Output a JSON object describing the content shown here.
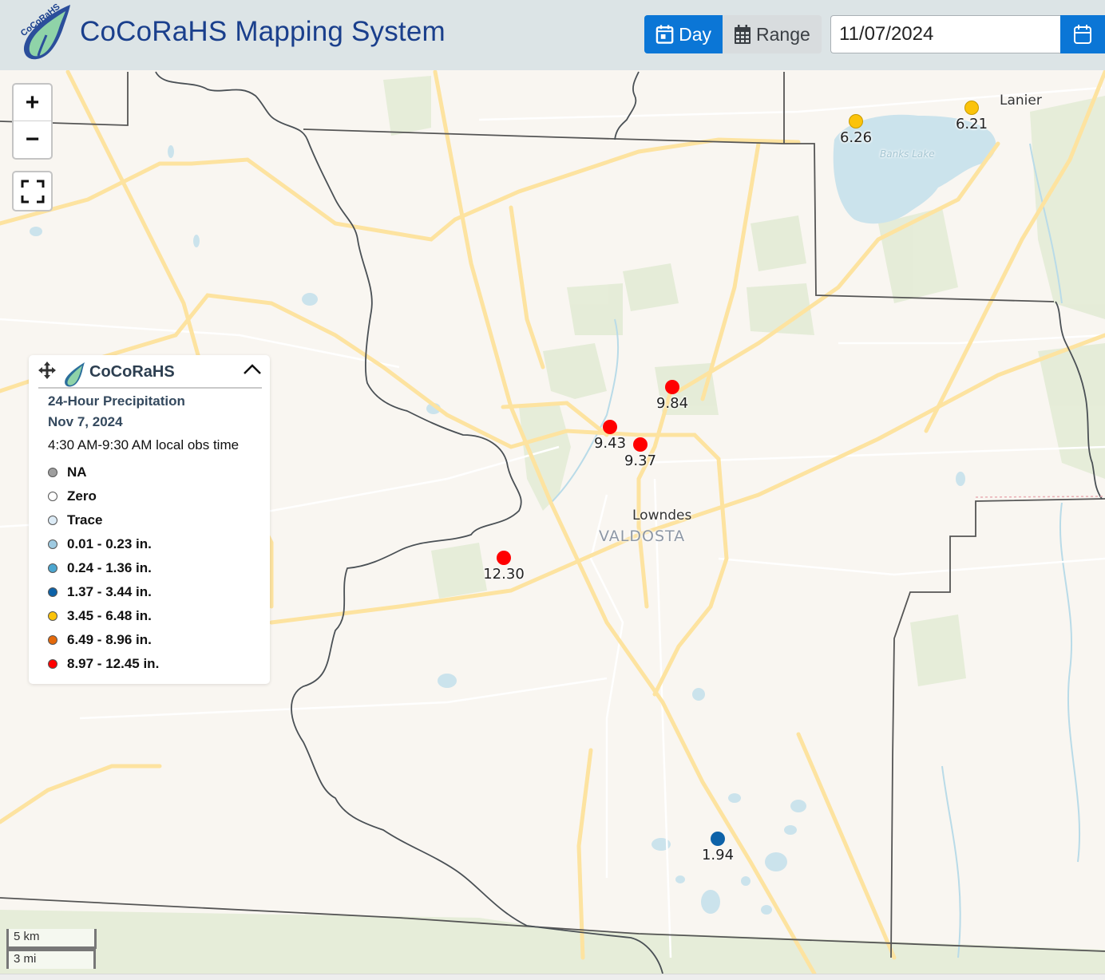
{
  "header": {
    "title": "CoCoRaHS Mapping System",
    "logo_text": "CoCoRaHS",
    "mode_buttons": [
      {
        "label": "Day",
        "icon": "calendar-day-icon",
        "active": true
      },
      {
        "label": "Range",
        "icon": "calendar-grid-icon",
        "active": false
      }
    ],
    "date_value": "11/07/2024",
    "date_picker_icon": "calendar-icon"
  },
  "map_controls": {
    "zoom_in": "+",
    "zoom_out": "−",
    "fullscreen_icon": "fullscreen-icon"
  },
  "legend": {
    "brand": "CoCoRaHS",
    "title": "24-Hour Precipitation",
    "date": "Nov 7, 2024",
    "obs_time": "4:30 AM-9:30 AM local obs time",
    "items": [
      {
        "label": "NA",
        "color": "#9e9e9e"
      },
      {
        "label": "Zero",
        "color": "#ffffff"
      },
      {
        "label": "Trace",
        "color": "#dcebf6"
      },
      {
        "label": "0.01 - 0.23 in.",
        "color": "#9ecae1"
      },
      {
        "label": "0.24 - 1.36 in.",
        "color": "#4ba6d0"
      },
      {
        "label": "1.37 - 3.44 in.",
        "color": "#0d62a8"
      },
      {
        "label": "3.45 - 6.48 in.",
        "color": "#fbc30a"
      },
      {
        "label": "6.49 - 8.96 in.",
        "color": "#e4690b"
      },
      {
        "label": "8.97 - 12.45 in.",
        "color": "#ff0000"
      }
    ]
  },
  "stations": [
    {
      "value": "6.26",
      "color": "#fbc30a"
    },
    {
      "value": "6.21",
      "color": "#fbc30a"
    },
    {
      "value": "9.84",
      "color": "#ff0000"
    },
    {
      "value": "9.43",
      "color": "#ff0000"
    },
    {
      "value": "9.37",
      "color": "#ff0000"
    },
    {
      "value": "12.30",
      "color": "#ff0000"
    },
    {
      "value": "1.94",
      "color": "#0d62a8"
    }
  ],
  "places": {
    "lanier": "Lanier",
    "banks_lake": "Banks Lake",
    "lowndes": "Lowndes",
    "valdosta": "VALDOSTA"
  },
  "scale": {
    "metric": "5 km",
    "imperial": "3 mi"
  }
}
